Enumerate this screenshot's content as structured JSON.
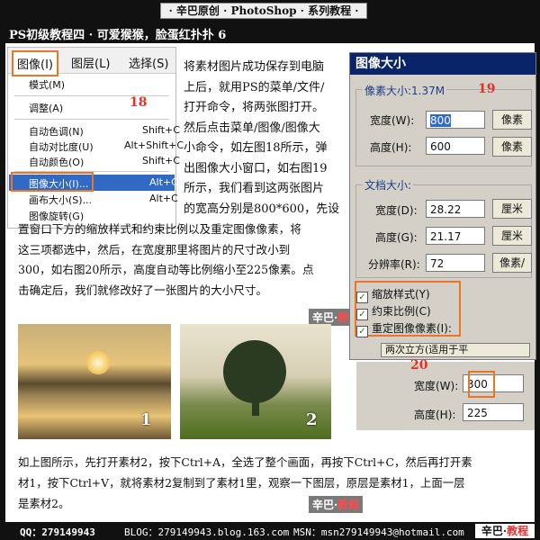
{
  "header": {
    "title": "· 辛巴原创 · PhotoShop · 系列教程 ·",
    "subtitle": "PS初级教程四 · 可爱猴猴，脸蛋红扑扑 6"
  },
  "menu": {
    "tabs": [
      "图像(I)",
      "图层(L)",
      "选择(S)"
    ],
    "items": [
      {
        "label": "模式(M)",
        "shortcut": ""
      },
      {
        "label": "调整(A)",
        "shortcut": ""
      },
      {
        "label": "自动色调(N)",
        "shortcut": "Shift+C"
      },
      {
        "label": "自动对比度(U)",
        "shortcut": "Alt+Shift+C"
      },
      {
        "label": "自动颜色(O)",
        "shortcut": "Shift+C"
      },
      {
        "label": "图像大小(I)...",
        "shortcut": "Alt+C"
      },
      {
        "label": "画布大小(S)...",
        "shortcut": "Alt+C"
      },
      {
        "label": "图像旋转(G)",
        "shortcut": ""
      }
    ],
    "number": "18"
  },
  "text": {
    "para_right": [
      "将素材图片成功保存到电脑",
      "上后，就用PS的菜单/文件/",
      "打开命令，将两张图打开。",
      "然后点击菜单/图像/图像大",
      "小命令，如左图18所示，弹",
      "出图像大小窗口，如右图19",
      "所示，我们看到这两张图片",
      "的宽高分别是800*600，先设"
    ],
    "para_full": [
      "置窗口下方的缩放样式和约束比例以及重定图像像素，将",
      "这三项都选中，然后，在宽度那里将图片的尺寸改小到",
      "300，如右图20所示，高度自动等比例缩小至225像素。点",
      "击确定后，我们就修改好了一张图片的大小尺寸。"
    ],
    "para_bottom": [
      "如上图所示，先打开素材2，按下Ctrl+A，全选了整个画面，再按下Ctrl+C，然后再打开素",
      "材1，按下Ctrl+V，就将素材2复制到了素材1里，观察一下图层，原层是素材1，上面一层",
      "是素材2。"
    ]
  },
  "dialog": {
    "title": "图像大小",
    "pixel_group": "像素大小:1.37M",
    "number": "19",
    "width_label": "宽度(W):",
    "width_value": "800",
    "height_label": "高度(H):",
    "height_value": "600",
    "unit_pixel": "像素",
    "doc_group": "文档大小:",
    "doc_width_label": "宽度(D):",
    "doc_width_value": "28.22",
    "doc_height_label": "高度(G):",
    "doc_height_value": "21.17",
    "resolution_label": "分辨率(R):",
    "resolution_value": "72",
    "unit_cm": "厘米",
    "unit_ppi": "像素/",
    "cb_scale": "缩放样式(Y)",
    "cb_constrain": "约束比例(C)",
    "cb_resample": "重定图像像素(I):",
    "bicubic": "两次立方(适用于平"
  },
  "dialog2": {
    "number": "20",
    "width_label": "宽度(W):",
    "width_value": "300",
    "height_label": "高度(H):",
    "height_value": "225"
  },
  "images": {
    "img1_number": "1",
    "img2_number": "2"
  },
  "watermark": {
    "prefix": "辛巴",
    "suffix": "教程",
    "separator": "·"
  },
  "footer": {
    "qq": "QQ：279149943",
    "blog": "BLOG：279149943.blog.163.com",
    "msn": "MSN：msn279149943@hotmail.com",
    "logo_prefix": "辛巴",
    "logo_suffix": "教程",
    "logo_separator": "·"
  },
  "colors": {
    "accent": "#e8772a",
    "number_red": "#e1322e",
    "title_bar": "#0a246a"
  }
}
